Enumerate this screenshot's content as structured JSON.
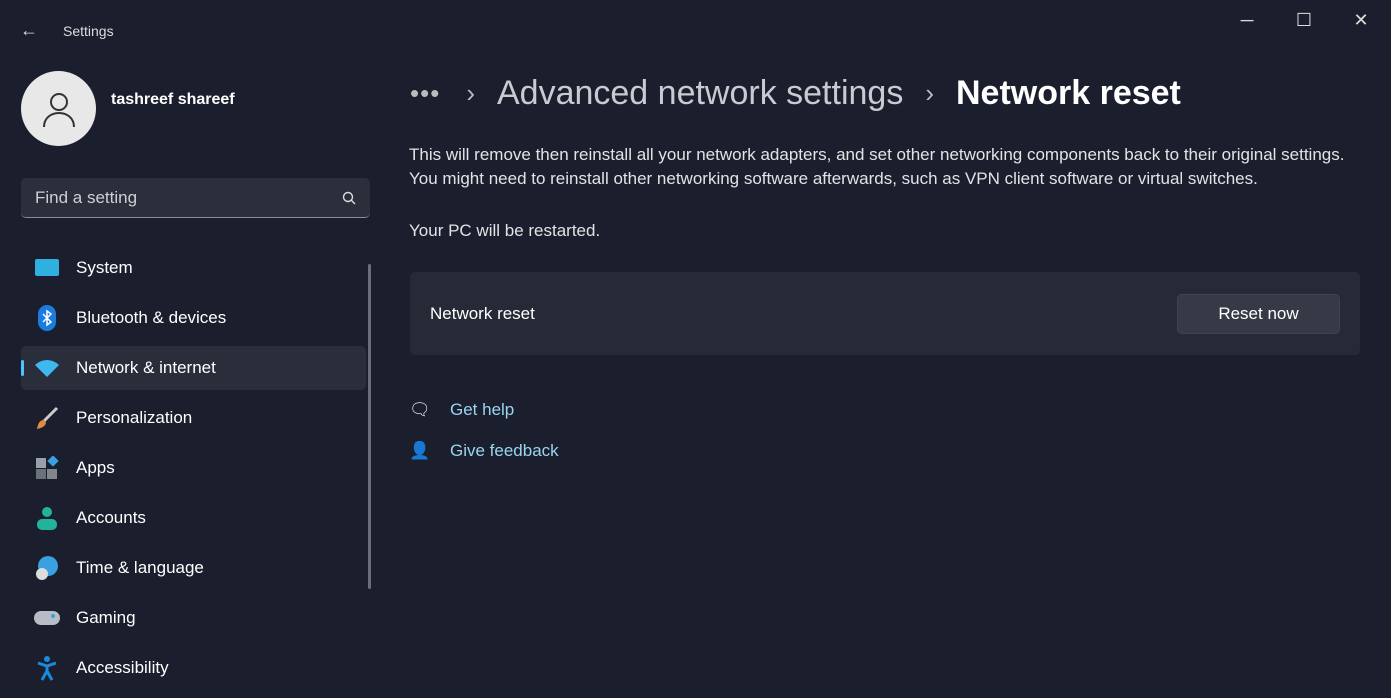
{
  "window": {
    "title": "Settings",
    "back_icon": "arrow-left-icon",
    "minimize": "─",
    "maximize": "☐",
    "close": "✕"
  },
  "user": {
    "name": "tashreef shareef"
  },
  "search": {
    "placeholder": "Find a setting",
    "value": ""
  },
  "nav": [
    {
      "label": "System",
      "icon": "system-display-icon",
      "color": "#2fb0e0"
    },
    {
      "label": "Bluetooth & devices",
      "icon": "bluetooth-icon",
      "color": "#1a7ce0"
    },
    {
      "label": "Network & internet",
      "icon": "wifi-icon",
      "color": "#3fb8f0",
      "selected": true
    },
    {
      "label": "Personalization",
      "icon": "paintbrush-icon",
      "color": "#e08a40"
    },
    {
      "label": "Apps",
      "icon": "apps-icon",
      "color": "#8a8f99"
    },
    {
      "label": "Accounts",
      "icon": "person-icon",
      "color": "#22b39a"
    },
    {
      "label": "Time & language",
      "icon": "globe-clock-icon",
      "color": "#3aa0e0"
    },
    {
      "label": "Gaming",
      "icon": "gamepad-icon",
      "color": "#b8bcc4"
    },
    {
      "label": "Accessibility",
      "icon": "accessibility-icon",
      "color": "#1a8ae0"
    }
  ],
  "breadcrumb": {
    "more": "•••",
    "parent": "Advanced network settings",
    "current": "Network reset"
  },
  "main": {
    "description": "This will remove then reinstall all your network adapters, and set other networking components back to their original settings. You might need to reinstall other networking software afterwards, such as VPN client software or virtual switches.",
    "restart_note": "Your PC will be restarted.",
    "card_title": "Network reset",
    "reset_button": "Reset now",
    "get_help": "Get help",
    "give_feedback": "Give feedback"
  },
  "accent": "#4cc2ff",
  "link_color": "#99d5f0"
}
